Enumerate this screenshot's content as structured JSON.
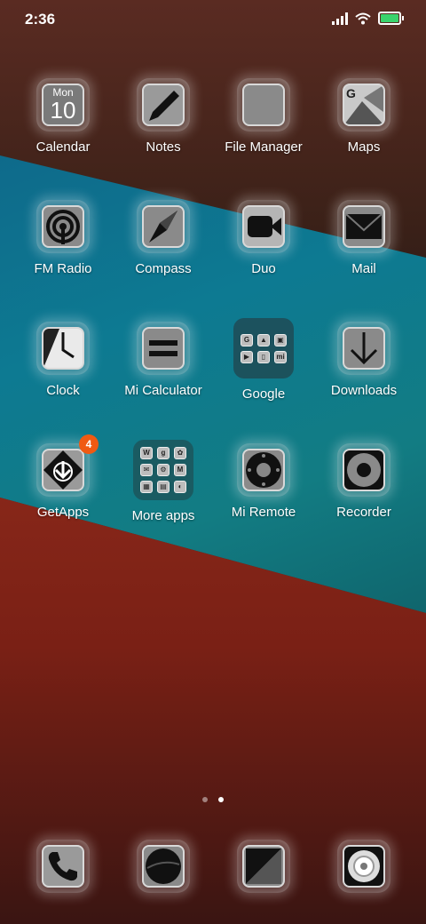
{
  "status_bar": {
    "time": "2:36"
  },
  "apps": [
    {
      "label": "Calendar",
      "icon": "calendar-icon",
      "day": "Mon",
      "date": "10"
    },
    {
      "label": "Notes",
      "icon": "notes-icon"
    },
    {
      "label": "File Manager",
      "icon": "file-manager-icon"
    },
    {
      "label": "Maps",
      "icon": "maps-icon"
    },
    {
      "label": "FM Radio",
      "icon": "radio-icon"
    },
    {
      "label": "Compass",
      "icon": "compass-icon"
    },
    {
      "label": "Duo",
      "icon": "video-camera-icon"
    },
    {
      "label": "Mail",
      "icon": "mail-icon"
    },
    {
      "label": "Clock",
      "icon": "clock-icon"
    },
    {
      "label": "Mi Calculator",
      "icon": "calculator-icon"
    },
    {
      "label": "Google",
      "icon": "folder-icon"
    },
    {
      "label": "Downloads",
      "icon": "download-icon"
    },
    {
      "label": "GetApps",
      "icon": "getapps-icon",
      "badge": "4"
    },
    {
      "label": "More apps",
      "icon": "folder-icon"
    },
    {
      "label": "Mi Remote",
      "icon": "remote-icon"
    },
    {
      "label": "Recorder",
      "icon": "recorder-icon"
    }
  ],
  "dock": [
    {
      "icon": "phone-icon"
    },
    {
      "icon": "messages-icon"
    },
    {
      "icon": "browser-icon"
    },
    {
      "icon": "camera-icon"
    }
  ],
  "folders": {
    "google_mini": [
      "G",
      "▲",
      "▣",
      "▶",
      "▯",
      "mi"
    ],
    "more_mini": [
      "W",
      "g",
      "✿",
      "✉",
      "⚙",
      "M",
      "▦",
      "▤",
      "◐"
    ]
  },
  "page_indicator": {
    "pages": 2,
    "current": 2
  },
  "colors": {
    "badge": "#f05a12",
    "battery": "#3ad36c"
  }
}
